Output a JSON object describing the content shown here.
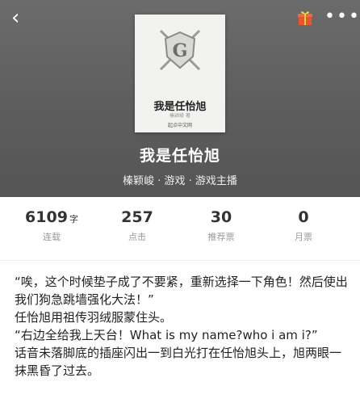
{
  "nav": {
    "back_icon": "‹",
    "more_icon": "•••"
  },
  "cover": {
    "title": "我是任怡旭",
    "author": "榛颖峻 著",
    "publisher": "起点中文网"
  },
  "book": {
    "title": "我是任怡旭",
    "meta": "榛颖峻 · 游戏 · 游戏主播"
  },
  "stats": [
    {
      "value": "6109",
      "unit": "字",
      "label": "连载"
    },
    {
      "value": "257",
      "unit": "",
      "label": "点击"
    },
    {
      "value": "30",
      "unit": "",
      "label": "推荐票"
    },
    {
      "value": "0",
      "unit": "",
      "label": "月票"
    }
  ],
  "content": [
    "“唉，这个时候垫子成了不要紧，重新选择一下角色！然后使出我们狗急跳墙强化大法！”",
    "任怡旭用祖传羽绒服蒙住头。",
    "“右边全给我上天台！What is my name?who i am i?”",
    "话音未落脚底的插座闪出一到白光打在任怡旭头上，旭两眼一抹黑昏了过去。"
  ],
  "colors": {
    "header_bg": "#5e5e5e",
    "gift": "#e8542c"
  }
}
